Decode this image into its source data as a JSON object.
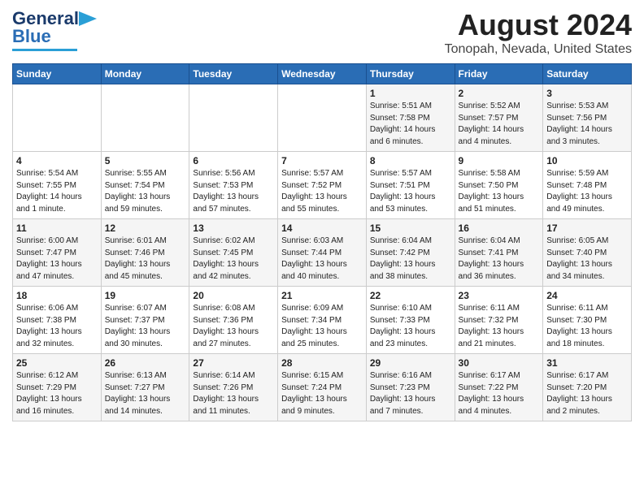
{
  "header": {
    "logo_line1": "General",
    "logo_line2": "Blue",
    "main_title": "August 2024",
    "subtitle": "Tonopah, Nevada, United States"
  },
  "days_of_week": [
    "Sunday",
    "Monday",
    "Tuesday",
    "Wednesday",
    "Thursday",
    "Friday",
    "Saturday"
  ],
  "weeks": [
    [
      {
        "day": "",
        "content": ""
      },
      {
        "day": "",
        "content": ""
      },
      {
        "day": "",
        "content": ""
      },
      {
        "day": "",
        "content": ""
      },
      {
        "day": "1",
        "content": "Sunrise: 5:51 AM\nSunset: 7:58 PM\nDaylight: 14 hours\nand 6 minutes."
      },
      {
        "day": "2",
        "content": "Sunrise: 5:52 AM\nSunset: 7:57 PM\nDaylight: 14 hours\nand 4 minutes."
      },
      {
        "day": "3",
        "content": "Sunrise: 5:53 AM\nSunset: 7:56 PM\nDaylight: 14 hours\nand 3 minutes."
      }
    ],
    [
      {
        "day": "4",
        "content": "Sunrise: 5:54 AM\nSunset: 7:55 PM\nDaylight: 14 hours\nand 1 minute."
      },
      {
        "day": "5",
        "content": "Sunrise: 5:55 AM\nSunset: 7:54 PM\nDaylight: 13 hours\nand 59 minutes."
      },
      {
        "day": "6",
        "content": "Sunrise: 5:56 AM\nSunset: 7:53 PM\nDaylight: 13 hours\nand 57 minutes."
      },
      {
        "day": "7",
        "content": "Sunrise: 5:57 AM\nSunset: 7:52 PM\nDaylight: 13 hours\nand 55 minutes."
      },
      {
        "day": "8",
        "content": "Sunrise: 5:57 AM\nSunset: 7:51 PM\nDaylight: 13 hours\nand 53 minutes."
      },
      {
        "day": "9",
        "content": "Sunrise: 5:58 AM\nSunset: 7:50 PM\nDaylight: 13 hours\nand 51 minutes."
      },
      {
        "day": "10",
        "content": "Sunrise: 5:59 AM\nSunset: 7:48 PM\nDaylight: 13 hours\nand 49 minutes."
      }
    ],
    [
      {
        "day": "11",
        "content": "Sunrise: 6:00 AM\nSunset: 7:47 PM\nDaylight: 13 hours\nand 47 minutes."
      },
      {
        "day": "12",
        "content": "Sunrise: 6:01 AM\nSunset: 7:46 PM\nDaylight: 13 hours\nand 45 minutes."
      },
      {
        "day": "13",
        "content": "Sunrise: 6:02 AM\nSunset: 7:45 PM\nDaylight: 13 hours\nand 42 minutes."
      },
      {
        "day": "14",
        "content": "Sunrise: 6:03 AM\nSunset: 7:44 PM\nDaylight: 13 hours\nand 40 minutes."
      },
      {
        "day": "15",
        "content": "Sunrise: 6:04 AM\nSunset: 7:42 PM\nDaylight: 13 hours\nand 38 minutes."
      },
      {
        "day": "16",
        "content": "Sunrise: 6:04 AM\nSunset: 7:41 PM\nDaylight: 13 hours\nand 36 minutes."
      },
      {
        "day": "17",
        "content": "Sunrise: 6:05 AM\nSunset: 7:40 PM\nDaylight: 13 hours\nand 34 minutes."
      }
    ],
    [
      {
        "day": "18",
        "content": "Sunrise: 6:06 AM\nSunset: 7:38 PM\nDaylight: 13 hours\nand 32 minutes."
      },
      {
        "day": "19",
        "content": "Sunrise: 6:07 AM\nSunset: 7:37 PM\nDaylight: 13 hours\nand 30 minutes."
      },
      {
        "day": "20",
        "content": "Sunrise: 6:08 AM\nSunset: 7:36 PM\nDaylight: 13 hours\nand 27 minutes."
      },
      {
        "day": "21",
        "content": "Sunrise: 6:09 AM\nSunset: 7:34 PM\nDaylight: 13 hours\nand 25 minutes."
      },
      {
        "day": "22",
        "content": "Sunrise: 6:10 AM\nSunset: 7:33 PM\nDaylight: 13 hours\nand 23 minutes."
      },
      {
        "day": "23",
        "content": "Sunrise: 6:11 AM\nSunset: 7:32 PM\nDaylight: 13 hours\nand 21 minutes."
      },
      {
        "day": "24",
        "content": "Sunrise: 6:11 AM\nSunset: 7:30 PM\nDaylight: 13 hours\nand 18 minutes."
      }
    ],
    [
      {
        "day": "25",
        "content": "Sunrise: 6:12 AM\nSunset: 7:29 PM\nDaylight: 13 hours\nand 16 minutes."
      },
      {
        "day": "26",
        "content": "Sunrise: 6:13 AM\nSunset: 7:27 PM\nDaylight: 13 hours\nand 14 minutes."
      },
      {
        "day": "27",
        "content": "Sunrise: 6:14 AM\nSunset: 7:26 PM\nDaylight: 13 hours\nand 11 minutes."
      },
      {
        "day": "28",
        "content": "Sunrise: 6:15 AM\nSunset: 7:24 PM\nDaylight: 13 hours\nand 9 minutes."
      },
      {
        "day": "29",
        "content": "Sunrise: 6:16 AM\nSunset: 7:23 PM\nDaylight: 13 hours\nand 7 minutes."
      },
      {
        "day": "30",
        "content": "Sunrise: 6:17 AM\nSunset: 7:22 PM\nDaylight: 13 hours\nand 4 minutes."
      },
      {
        "day": "31",
        "content": "Sunrise: 6:17 AM\nSunset: 7:20 PM\nDaylight: 13 hours\nand 2 minutes."
      }
    ]
  ]
}
